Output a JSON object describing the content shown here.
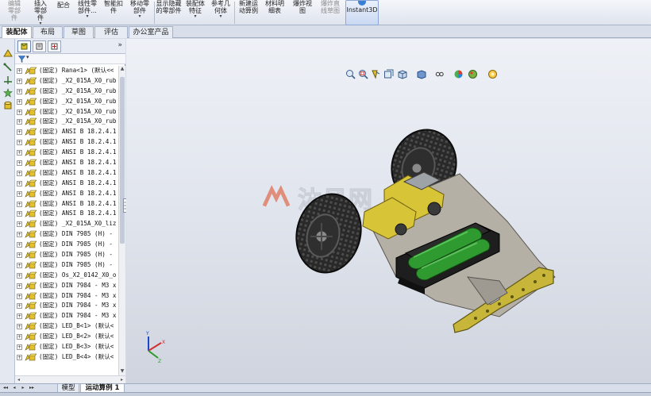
{
  "ribbon": {
    "edit_component": "编辑零部件",
    "insert_component": "插入零部件",
    "mate": "配合",
    "linear_pattern": "线性零部件...",
    "smart_fasteners": "智能扣件",
    "move_component": "移动零部件",
    "show_hidden": "显示隐藏的零部件",
    "assembly_features": "装配体特征",
    "reference_geometry": "参考几何体",
    "new_motion_study": "新建运动算例",
    "bom": "材料明细表",
    "exploded_view": "爆炸视图",
    "explode_line_sketch": "爆炸直线草图",
    "instant3d": "Instant3D",
    "dropdown_arrow": "▾"
  },
  "tabs": [
    "装配体",
    "布局",
    "草图",
    "评估",
    "办公室产品"
  ],
  "panel": {
    "expand_glyph": "»",
    "filter_glyph": "▾",
    "tree_rows": [
      "(固定) Rana<1> (默认<<",
      "(固定) _X2_015A_X0_rub",
      "(固定) _X2_015A_X0_rub",
      "(固定) _X2_015A_X0_rub",
      "(固定) _X2_015A_X0_rub",
      "(固定) _X2_015A_X0_rub",
      "(固定) ANSI B 18.2.4.1",
      "(固定) ANSI B 18.2.4.1",
      "(固定) ANSI B 18.2.4.1",
      "(固定) ANSI B 18.2.4.1",
      "(固定) ANSI B 18.2.4.1",
      "(固定) ANSI B 18.2.4.1",
      "(固定) ANSI B 18.2.4.1",
      "(固定) ANSI B 18.2.4.1",
      "(固定) ANSI B 18.2.4.1",
      "(固定) _X2_015A_X0_liz",
      "(固定) DIN 7985 (H) -",
      "(固定) DIN 7985 (H) -",
      "(固定) DIN 7985 (H) -",
      "(固定) DIN 7985 (H) -",
      "(固定) Os_X2_0142_X0_o",
      "(固定) DIN 7984 - M3 x",
      "(固定) DIN 7984 - M3 x",
      "(固定) DIN 7984 - M3 x",
      "(固定) DIN 7984 - M3 x",
      "(固定) LED_B<1> (默认<",
      "(固定) LED_B<2> (默认<",
      "(固定) LED_B<3> (默认<",
      "(固定) LED_B<4> (默认<"
    ],
    "plus_glyph": "+"
  },
  "viewport": {
    "watermark_text": "沐风网",
    "watermark_url": "www.mfcad.com",
    "triad_x": "X",
    "triad_y": "Y",
    "triad_z": "Z"
  },
  "bottom_tabs": {
    "nav_first": "◂◂",
    "nav_prev": "◂",
    "nav_next": "▸",
    "nav_last": "▸▸",
    "model": "模型",
    "motion_study": "运动算例 1"
  },
  "colors": {
    "ribbon_bg": "#e8ecf3",
    "accent": "#3a7fd5",
    "battery_green": "#2f9a2f",
    "motor_yellow": "#d8c437",
    "board_olive": "#c7b63a"
  }
}
